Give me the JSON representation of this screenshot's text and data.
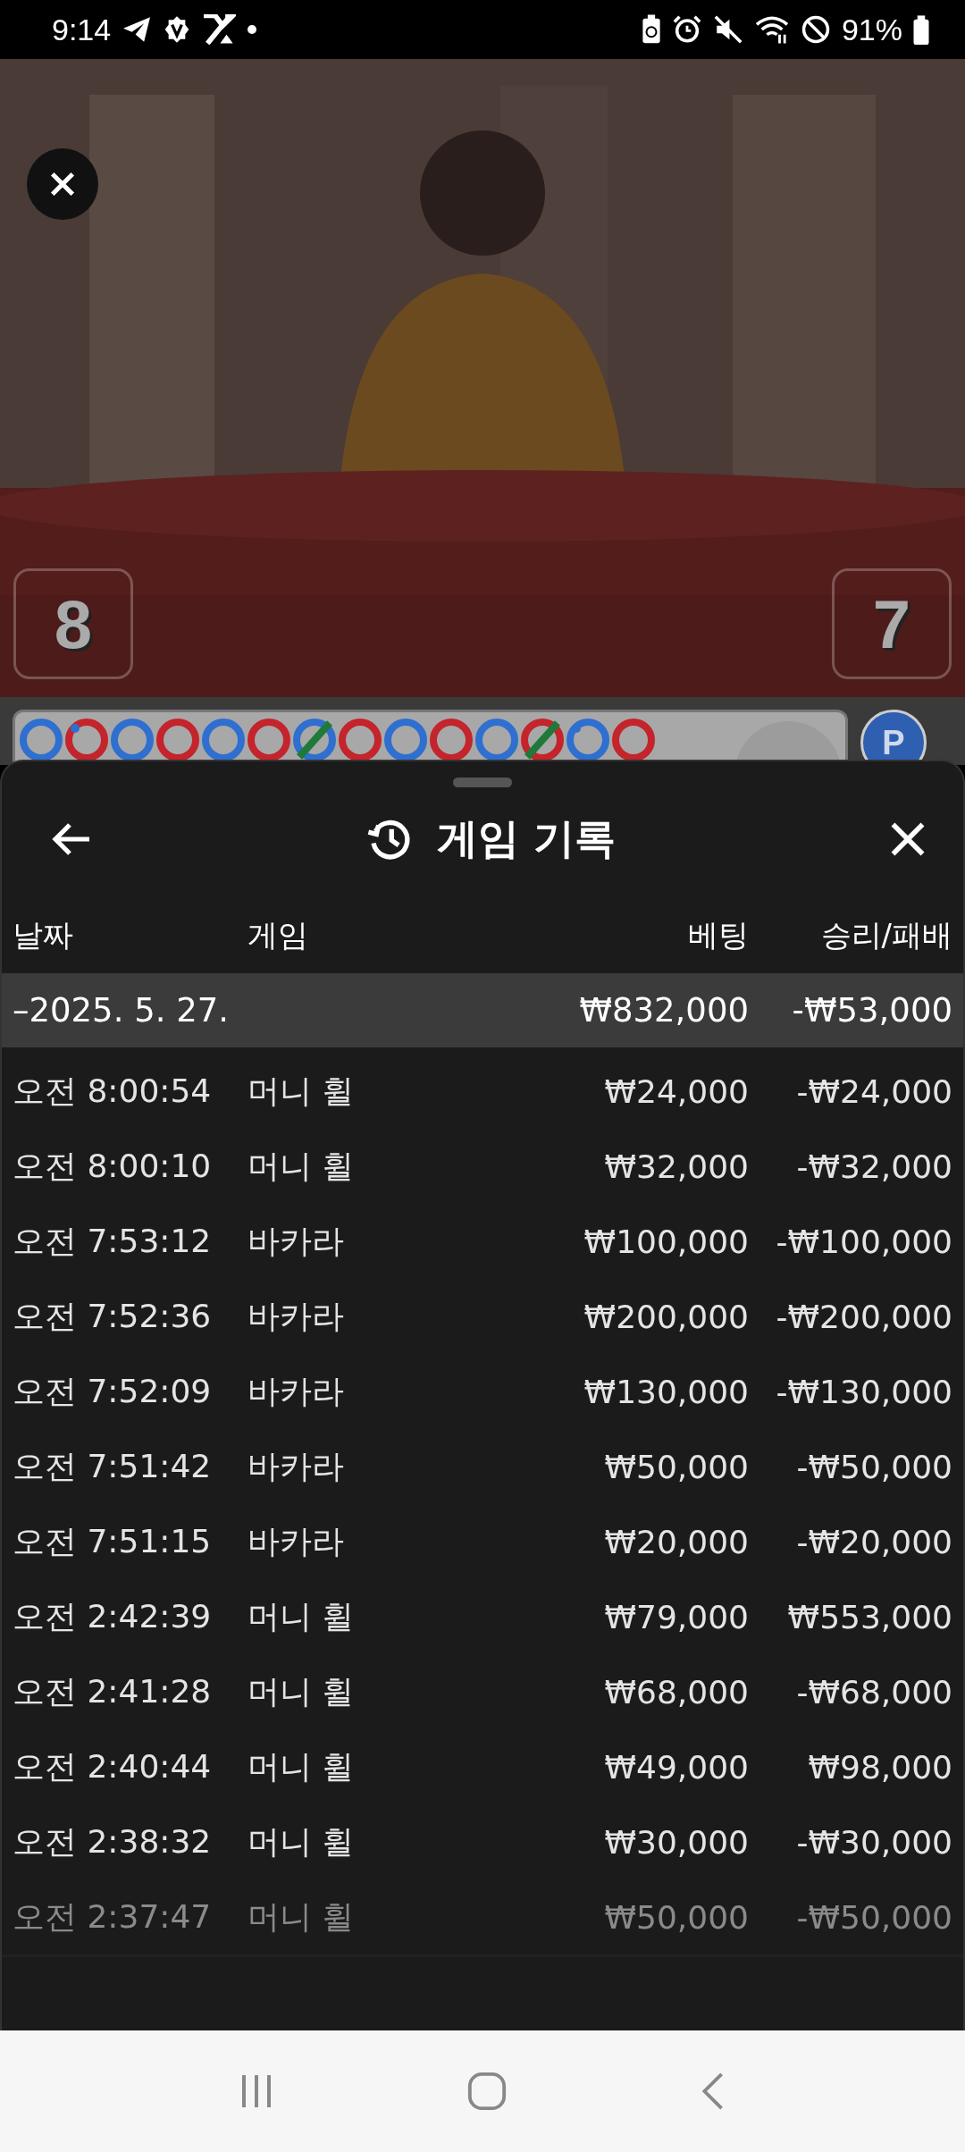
{
  "status_bar": {
    "time": "9:14",
    "battery": "91%"
  },
  "video": {
    "kind": "picture",
    "scores": [
      "8",
      "7"
    ]
  },
  "bead_road": {
    "beads": [
      {
        "color": "#2f6fd0",
        "tie": false,
        "pair": false
      },
      {
        "color": "#c4242b",
        "tie": false,
        "pair": true
      },
      {
        "color": "#2f6fd0",
        "tie": false,
        "pair": false
      },
      {
        "color": "#c4242b",
        "tie": false,
        "pair": false
      },
      {
        "color": "#2f6fd0",
        "tie": false,
        "pair": false
      },
      {
        "color": "#c4242b",
        "tie": false,
        "pair": false
      },
      {
        "color": "#2f6fd0",
        "tie": true,
        "pair": false
      },
      {
        "color": "#c4242b",
        "tie": false,
        "pair": false
      },
      {
        "color": "#2f6fd0",
        "tie": false,
        "pair": false
      },
      {
        "color": "#c4242b",
        "tie": false,
        "pair": false
      },
      {
        "color": "#2f6fd0",
        "tie": false,
        "pair": false
      },
      {
        "color": "#c4242b",
        "tie": true,
        "pair": false
      },
      {
        "color": "#2f6fd0",
        "tie": false,
        "pair": true
      },
      {
        "color": "#c4242b",
        "tie": false,
        "pair": false
      }
    ],
    "player_button": "P"
  },
  "sheet": {
    "title": "게임 기록",
    "columns": [
      "날짜",
      "게임",
      "베팅",
      "승리/패배"
    ],
    "summary": {
      "date": "–2025. 5. 27.",
      "bet": "₩832,000",
      "result": "-₩53,000"
    },
    "rows": [
      {
        "time": "오전 8:00:54",
        "game": "머니 휠",
        "bet": "₩24,000",
        "result": "-₩24,000",
        "dimmed": false
      },
      {
        "time": "오전 8:00:10",
        "game": "머니 휠",
        "bet": "₩32,000",
        "result": "-₩32,000",
        "dimmed": false
      },
      {
        "time": "오전 7:53:12",
        "game": "바카라",
        "bet": "₩100,000",
        "result": "-₩100,000",
        "dimmed": false
      },
      {
        "time": "오전 7:52:36",
        "game": "바카라",
        "bet": "₩200,000",
        "result": "-₩200,000",
        "dimmed": false
      },
      {
        "time": "오전 7:52:09",
        "game": "바카라",
        "bet": "₩130,000",
        "result": "-₩130,000",
        "dimmed": false
      },
      {
        "time": "오전 7:51:42",
        "game": "바카라",
        "bet": "₩50,000",
        "result": "-₩50,000",
        "dimmed": false
      },
      {
        "time": "오전 7:51:15",
        "game": "바카라",
        "bet": "₩20,000",
        "result": "-₩20,000",
        "dimmed": false
      },
      {
        "time": "오전 2:42:39",
        "game": "머니 휠",
        "bet": "₩79,000",
        "result": "₩553,000",
        "dimmed": false
      },
      {
        "time": "오전 2:41:28",
        "game": "머니 휠",
        "bet": "₩68,000",
        "result": "-₩68,000",
        "dimmed": false
      },
      {
        "time": "오전 2:40:44",
        "game": "머니 휠",
        "bet": "₩49,000",
        "result": "₩98,000",
        "dimmed": false
      },
      {
        "time": "오전 2:38:32",
        "game": "머니 휠",
        "bet": "₩30,000",
        "result": "-₩30,000",
        "dimmed": false
      },
      {
        "time": "오전 2:37:47",
        "game": "머니 휠",
        "bet": "₩50,000",
        "result": "-₩50,000",
        "dimmed": true
      }
    ]
  }
}
